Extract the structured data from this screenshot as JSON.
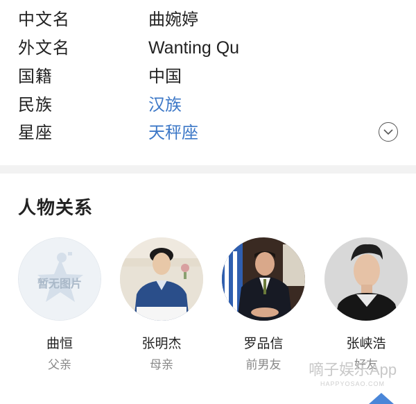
{
  "info": {
    "rows": [
      {
        "key": "中文名",
        "value": "曲婉婷"
      },
      {
        "key": "外文名",
        "value": "Wanting Qu"
      },
      {
        "key": "国籍",
        "value": "中国"
      },
      {
        "key": "民族",
        "value": "汉族"
      },
      {
        "key": "星座",
        "value": "天秤座"
      }
    ],
    "link_color": "#3d78c7"
  },
  "relations": {
    "title": "人物关系",
    "people": [
      {
        "name": "曲恒",
        "relation": "父亲",
        "avatar_text": "暂无图片"
      },
      {
        "name": "张明杰",
        "relation": "母亲"
      },
      {
        "name": "罗品信",
        "relation": "前男友"
      },
      {
        "name": "张峡浩",
        "relation": "好友"
      }
    ]
  },
  "watermark": {
    "text": "嘀子娱乐App",
    "sub": "HAPPYOSAO.COM"
  }
}
